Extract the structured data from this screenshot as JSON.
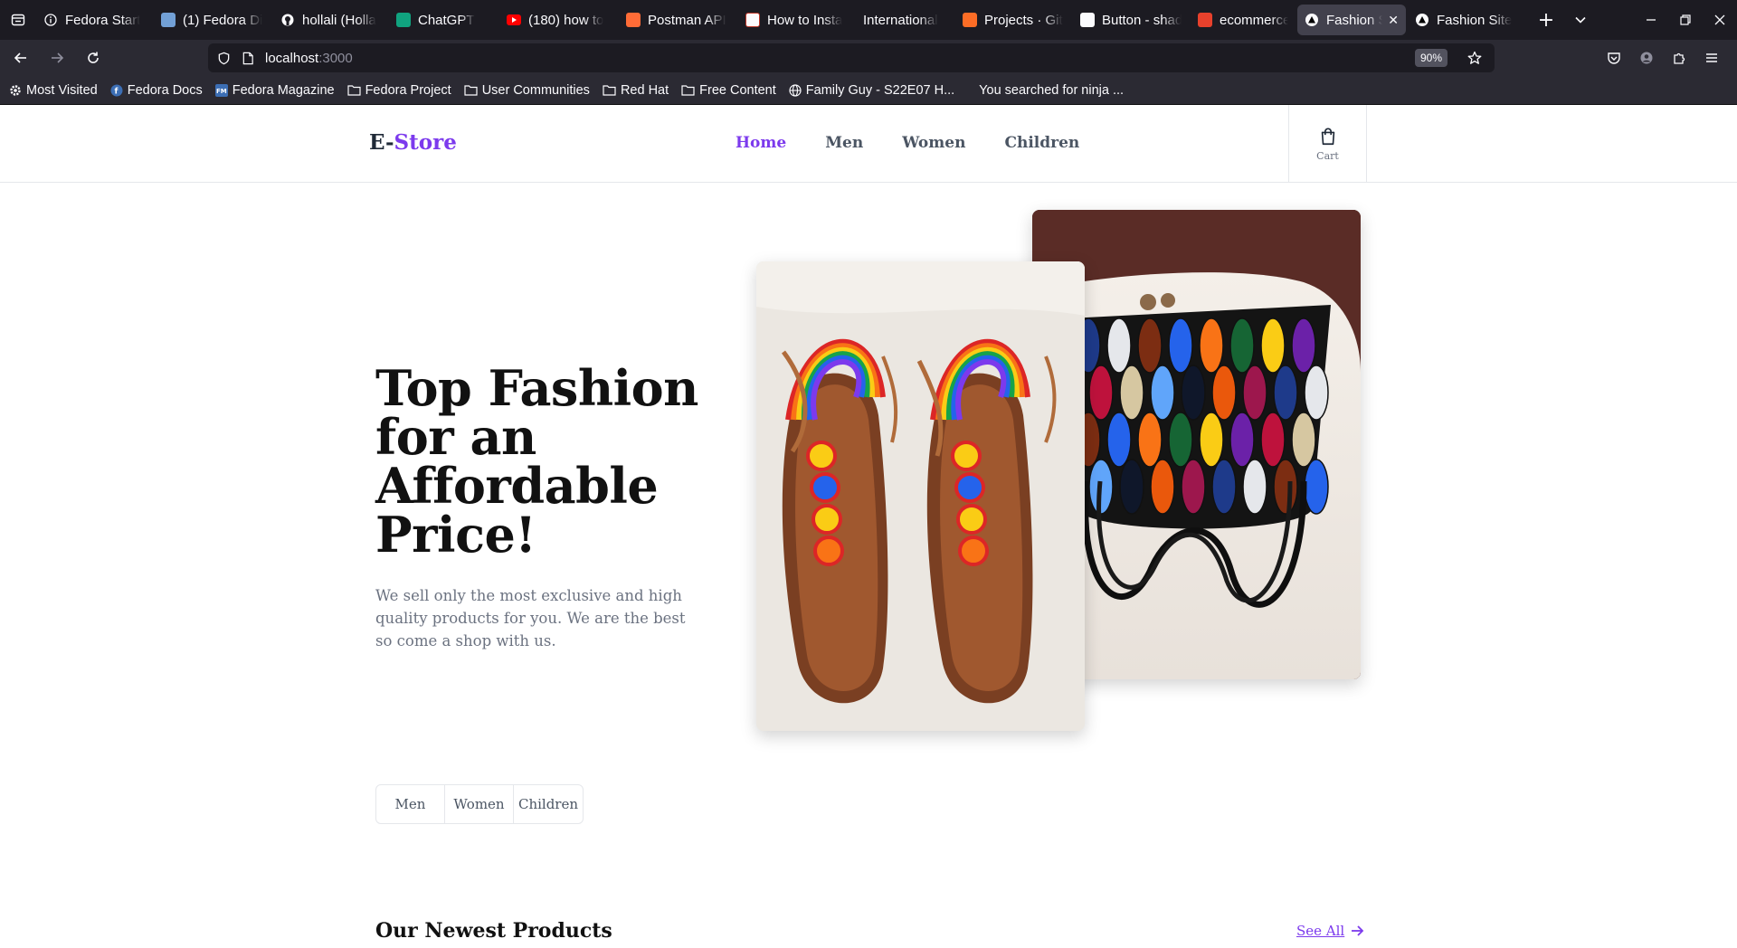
{
  "browser": {
    "tabs": [
      {
        "label": "Fedora Start",
        "icon": "info-icon",
        "color": "#fbfbfe"
      },
      {
        "label": "(1) Fedora Di",
        "icon": "discourse-icon",
        "color": "#72a0d6"
      },
      {
        "label": "hollali (Holla",
        "icon": "github-icon",
        "color": "#fbfbfe"
      },
      {
        "label": "ChatGPT",
        "icon": "chatgpt-icon",
        "color": "#10a37f"
      },
      {
        "label": "(180) how to",
        "icon": "youtube-icon",
        "color": "#ff0000"
      },
      {
        "label": "Postman API",
        "icon": "postman-icon",
        "color": "#ff6c37"
      },
      {
        "label": "How to Insta",
        "icon": "lt-icon",
        "color": "#fbfbfe"
      },
      {
        "label": "International",
        "icon": "blank-icon",
        "color": "#1c1b22"
      },
      {
        "label": "Projects · Git",
        "icon": "gitlab-icon",
        "color": "#fc6d26"
      },
      {
        "label": "Button - shad",
        "icon": "shadcn-icon",
        "color": "#fbfbfe"
      },
      {
        "label": "ecommerce-",
        "icon": "scribd-icon",
        "color": "#e8412c"
      },
      {
        "label": "Fashion Si",
        "icon": "vercel-icon",
        "color": "#fbfbfe"
      },
      {
        "label": "Fashion Site",
        "icon": "vercel-icon",
        "color": "#fbfbfe"
      }
    ],
    "active_tab_index": 11,
    "url_host": "localhost",
    "url_port": ":3000",
    "zoom": "90%",
    "bookmarks": [
      {
        "label": "Most Visited",
        "icon": "gear-icon"
      },
      {
        "label": "Fedora Docs",
        "icon": "fedora-icon"
      },
      {
        "label": "Fedora Magazine",
        "icon": "fm-icon"
      },
      {
        "label": "Fedora Project",
        "icon": "folder-icon"
      },
      {
        "label": "User Communities",
        "icon": "folder-icon"
      },
      {
        "label": "Red Hat",
        "icon": "folder-icon"
      },
      {
        "label": "Free Content",
        "icon": "folder-icon"
      },
      {
        "label": "Family Guy - S22E07 H...",
        "icon": "globe-icon"
      },
      {
        "label": "You searched for ninja ...",
        "icon": "blank-icon"
      }
    ]
  },
  "site": {
    "logo_prefix": "E-",
    "logo_accent": "Store",
    "nav": [
      {
        "label": "Home",
        "active": true
      },
      {
        "label": "Men",
        "active": false
      },
      {
        "label": "Women",
        "active": false
      },
      {
        "label": "Children",
        "active": false
      }
    ],
    "cart_label": "Cart",
    "hero_title": "Top Fashion for an Affordable Price!",
    "hero_subtitle": "We sell only the most exclusive and high quality products for you. We are the best so come a shop with us.",
    "categories": [
      "Men",
      "Women",
      "Children"
    ],
    "newest_heading": "Our Newest Products",
    "see_all": "See All",
    "accent_color": "#7c3aed"
  }
}
